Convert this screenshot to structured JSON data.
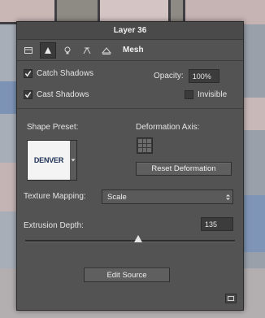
{
  "panel": {
    "title": "Layer 36",
    "tabs": [
      {
        "icon": "scene-icon"
      },
      {
        "icon": "shape-icon"
      },
      {
        "icon": "light-icon"
      },
      {
        "icon": "camera-icon"
      },
      {
        "icon": "mesh-icon"
      }
    ],
    "active_tab_label": "Mesh"
  },
  "shadows": {
    "catch_label": "Catch Shadows",
    "catch_checked": true,
    "cast_label": "Cast Shadows",
    "cast_checked": true,
    "opacity_label": "Opacity:",
    "opacity_value": "100%",
    "invisible_label": "Invisible",
    "invisible_checked": false
  },
  "shape_preset": {
    "label": "Shape Preset:",
    "thumbnail_text": "DENVER"
  },
  "deformation": {
    "axis_label": "Deformation Axis:",
    "reset_label": "Reset Deformation"
  },
  "texture": {
    "label": "Texture Mapping:",
    "value": "Scale"
  },
  "extrusion": {
    "label": "Extrusion Depth:",
    "value": "135"
  },
  "edit_source_label": "Edit Source",
  "colors": {
    "panel_bg": "#535353",
    "field_bg": "#3c3c3c",
    "thumbnail_text": "#1c2f54"
  }
}
